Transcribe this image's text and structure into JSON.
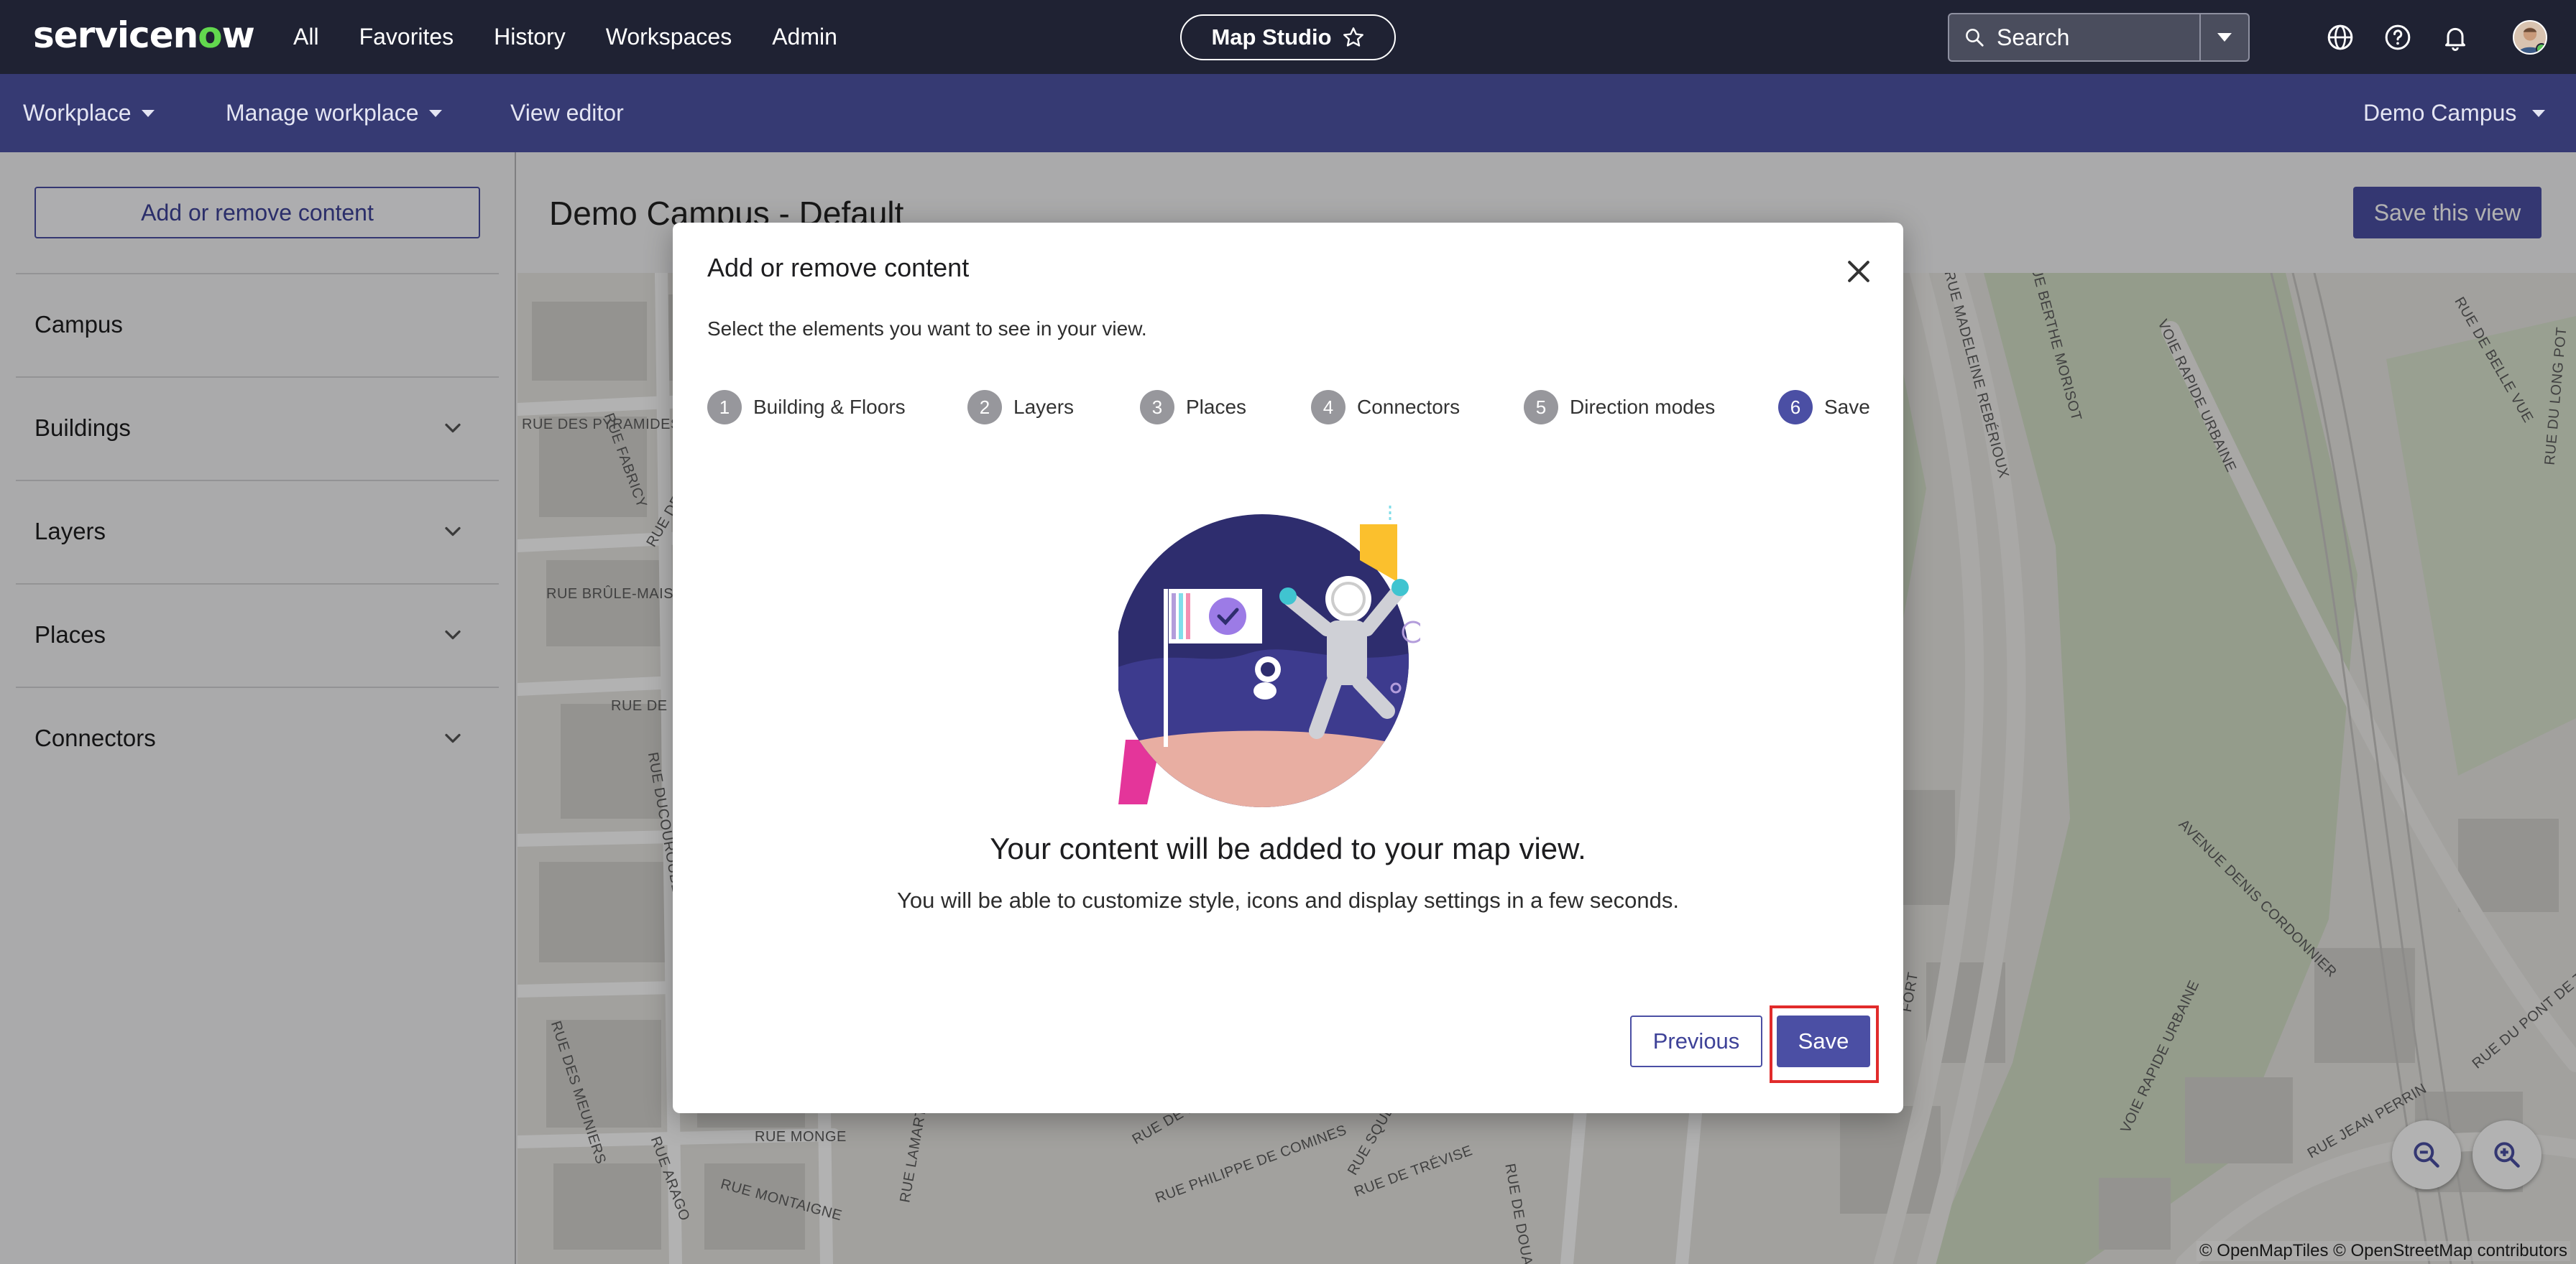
{
  "topnav": {
    "logo": "servicenow",
    "menu": [
      "All",
      "Favorites",
      "History",
      "Workspaces",
      "Admin"
    ],
    "studio_label": "Map Studio",
    "search_placeholder": "Search",
    "icons": [
      "globe-icon",
      "help-icon",
      "bell-icon"
    ]
  },
  "subnav": {
    "workplace": "Workplace",
    "manage": "Manage workplace",
    "view_editor": "View editor",
    "campus": "Demo Campus"
  },
  "sidebar": {
    "add_button": "Add or remove content",
    "items": [
      {
        "label": "Campus",
        "expandable": false
      },
      {
        "label": "Buildings",
        "expandable": true
      },
      {
        "label": "Layers",
        "expandable": true
      },
      {
        "label": "Places",
        "expandable": true
      },
      {
        "label": "Connectors",
        "expandable": true
      }
    ]
  },
  "main": {
    "title": "Demo Campus - Default",
    "save_view": "Save this view"
  },
  "map": {
    "streets": [
      "RUE DES PYRAMIDES",
      "RUE FABRICY",
      "RUE DE FLEURUS",
      "RUE BRÛLE-MAISON",
      "RUE DE LE",
      "RUE DUCOUROUBLE",
      "RUE DES MEUNIERS",
      "RUE MONGE",
      "RUE ARAGO",
      "RUE MONTAIGNE",
      "RUE LAMARTINE",
      "RUE PHILIPPE DE COMINES",
      "RUE DE LA",
      "RUE SQUEU",
      "RUE DE TRÉVISE",
      "RUE DE DOUA",
      "RUE MADELEINE REBÉRIOUX",
      "RUE BERTHE MORISOT",
      "VOIE RAPIDE URBAINE",
      "RUE DE BELLE VUE",
      "RUE DU LONG POT",
      "AVENUE DENIS CORDONNIER",
      "RUE JEAN PERRIN",
      "RUE DU PONT DE T",
      "FORT",
      "VOIE RAPIDE URBAINE"
    ],
    "attribution": "© OpenMapTiles © OpenStreetMap contributors",
    "zoom_out_icon": "zoom-out-icon",
    "zoom_in_icon": "zoom-in-icon"
  },
  "modal": {
    "title": "Add or remove content",
    "subtitle": "Select the elements you want to see in your view.",
    "steps": [
      {
        "num": "1",
        "label": "Building & Floors"
      },
      {
        "num": "2",
        "label": "Layers"
      },
      {
        "num": "3",
        "label": "Places"
      },
      {
        "num": "4",
        "label": "Connectors"
      },
      {
        "num": "5",
        "label": "Direction modes"
      },
      {
        "num": "6",
        "label": "Save",
        "active": true
      }
    ],
    "heading": "Your content will be added to your map view.",
    "description": "You will be able to customize style, icons and display settings in a few seconds.",
    "previous": "Previous",
    "save": "Save"
  },
  "colors": {
    "topnav": "#1f2233",
    "subnav": "#363a73",
    "accent": "#4b4fa4",
    "highlight": "#e12b2b"
  }
}
